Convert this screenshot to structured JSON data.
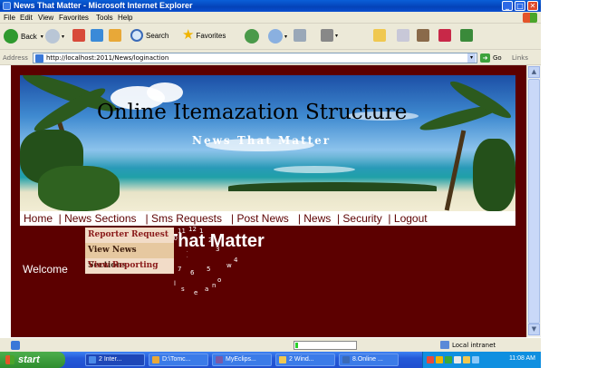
{
  "window": {
    "title": "News That Matter - Microsoft Internet Explorer",
    "controls": [
      "_",
      "□",
      "✕"
    ]
  },
  "menubar": {
    "items": [
      "File",
      "Edit",
      "View",
      "Favorites",
      "Tools",
      "Help"
    ]
  },
  "toolbar": {
    "back_label": "Back",
    "search_label": "Search",
    "favorites_label": "Favorites"
  },
  "addressbar": {
    "label": "Address",
    "url": "http://localhost:2011/News/loginaction",
    "go_label": "Go",
    "links_label": "Links"
  },
  "page": {
    "banner_title": "Online Itemazation Structure",
    "banner_subtitle": "News That Matter",
    "nav": [
      "Home",
      "News Sections",
      "Sms Requests",
      "Post News",
      "News",
      "Security",
      "Logout"
    ],
    "dropdown": [
      "Reporter Request",
      "View News Sections",
      "View Reporting"
    ],
    "dropdown_selected_index": 1,
    "heading": "That Matter",
    "welcome_text": "Welcome",
    "clock_digits": [
      "11",
      "12",
      "1",
      "10",
      "2",
      "9",
      "3",
      "8",
      "4",
      "7",
      "6",
      "5",
      "a",
      "s",
      "e",
      "n",
      "o",
      "l",
      "w"
    ]
  },
  "statusbar": {
    "zone_label": "Local intranet",
    "progress": 0.05
  },
  "taskbar": {
    "start_label": "start",
    "tasks": [
      "2 Inter...",
      "D:\\Tomc...",
      "MyEclips...",
      "2 Wind...",
      "8.Online ..."
    ],
    "clock": "11:08 AM"
  },
  "colors": {
    "page_background": "#5c0000",
    "nav_text": "#5c0000",
    "dropdown_bg": "#f2dcc8",
    "dropdown_selected_bg": "#e6c8a0",
    "titlebar": "#0a5fd8"
  }
}
